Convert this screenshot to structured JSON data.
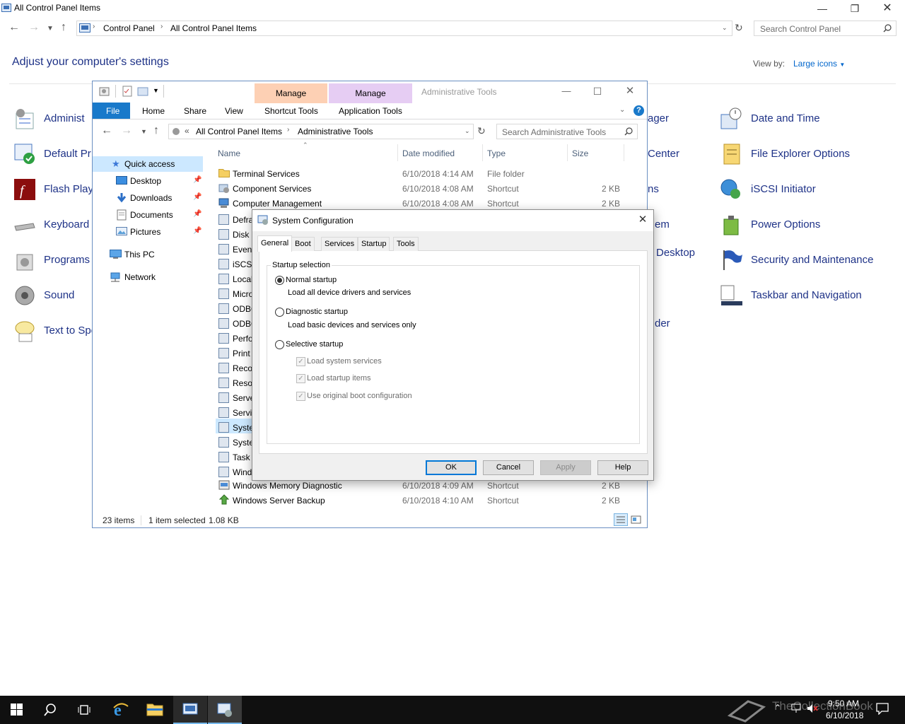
{
  "control_panel": {
    "title": "All Control Panel Items",
    "breadcrumb": [
      "Control Panel",
      "All Control Panel Items"
    ],
    "search_placeholder": "Search Control Panel",
    "heading": "Adjust your computer's settings",
    "view_by_label": "View by:",
    "view_by_value": "Large icons",
    "left_items": [
      "Administ",
      "Default Pr",
      "Flash Play",
      "Keyboard",
      "Programs",
      "Sound",
      "Text to Spe"
    ],
    "mid_items": [
      "ager",
      "Center",
      "ns",
      "em",
      "Desktop",
      "der"
    ],
    "right_items": [
      "Date and Time",
      "File Explorer Options",
      "iSCSI Initiator",
      "Power Options",
      "Security and Maintenance",
      "Taskbar and Navigation"
    ]
  },
  "explorer": {
    "title": "Administrative Tools",
    "ctx_tabs": {
      "manage1": "Manage",
      "manage2": "Manage"
    },
    "ribbon_tabs": {
      "file": "File",
      "home": "Home",
      "share": "Share",
      "view": "View",
      "shortcut_tools": "Shortcut Tools",
      "application_tools": "Application Tools"
    },
    "breadcrumb": {
      "prefix": "«",
      "part1": "All Control Panel Items",
      "part2": "Administrative Tools"
    },
    "search_placeholder": "Search Administrative Tools",
    "nav": {
      "quick_access": "Quick access",
      "desktop": "Desktop",
      "downloads": "Downloads",
      "documents": "Documents",
      "pictures": "Pictures",
      "this_pc": "This PC",
      "network": "Network"
    },
    "columns": {
      "name": "Name",
      "date": "Date modified",
      "type": "Type",
      "size": "Size"
    },
    "rows_full": [
      {
        "name": "Terminal Services",
        "date": "6/10/2018 4:14 AM",
        "type": "File folder",
        "size": ""
      },
      {
        "name": "Component Services",
        "date": "6/10/2018 4:08 AM",
        "type": "Shortcut",
        "size": "2 KB"
      },
      {
        "name": "Computer Management",
        "date": "6/10/2018 4:08 AM",
        "type": "Shortcut",
        "size": "2 KB"
      }
    ],
    "rows_partial": [
      "Defra",
      "Disk C",
      "Event",
      "iSCSI",
      "Local",
      "Micro",
      "ODBC",
      "ODBC",
      "Perfo",
      "Print",
      "Reco",
      "Resor",
      "Serve",
      "Servi",
      "Syste",
      "Syste",
      "Task",
      "Wind"
    ],
    "rows_bottom": [
      {
        "name": "Windows Memory Diagnostic",
        "date": "6/10/2018 4:09 AM",
        "type": "Shortcut",
        "size": "2 KB"
      },
      {
        "name": "Windows Server Backup",
        "date": "6/10/2018 4:10 AM",
        "type": "Shortcut",
        "size": "2 KB"
      }
    ],
    "status": {
      "items": "23 items",
      "selected": "1 item selected",
      "size": "1.08 KB"
    }
  },
  "dialog": {
    "title": "System Configuration",
    "tabs": {
      "general": "General",
      "boot": "Boot",
      "services": "Services",
      "startup": "Startup",
      "tools": "Tools"
    },
    "group_label": "Startup selection",
    "normal": "Normal startup",
    "normal_desc": "Load all device drivers and services",
    "diagnostic": "Diagnostic startup",
    "diagnostic_desc": "Load basic devices and services only",
    "selective": "Selective startup",
    "cb1": "Load system services",
    "cb2": "Load startup items",
    "cb3": "Use original boot configuration",
    "buttons": {
      "ok": "OK",
      "cancel": "Cancel",
      "apply": "Apply",
      "help": "Help"
    }
  },
  "taskbar": {
    "time": "9:50 AM",
    "date": "6/10/2018",
    "watermark": "TheCollectionBook"
  }
}
